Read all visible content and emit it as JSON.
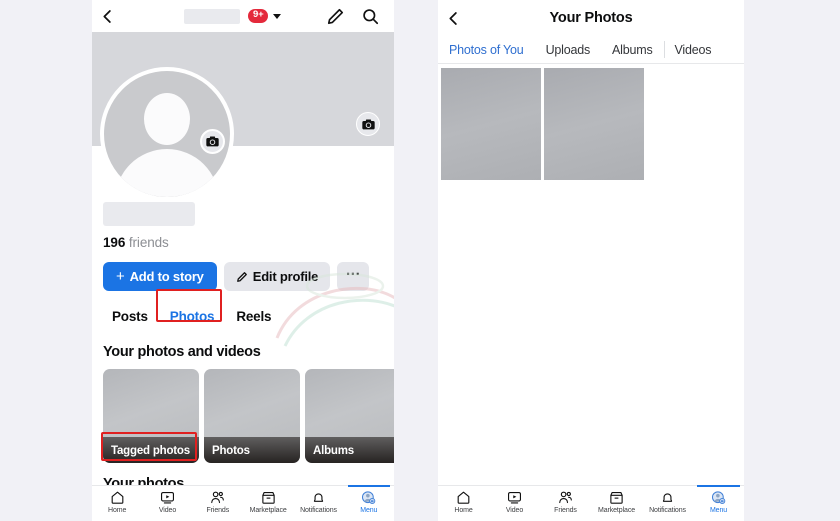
{
  "left_panel": {
    "topbar": {
      "back_icon": "chevron-left-icon",
      "name_placeholder": "",
      "notification_badge": "9+",
      "caret_icon": "chevron-down-icon",
      "edit_icon": "pencil-icon",
      "search_icon": "search-icon"
    },
    "cover": {
      "camera_icon": "camera-icon",
      "avatar_camera_icon": "camera-icon",
      "avatar": "default-avatar-placeholder"
    },
    "identity": {
      "name_placeholder": "",
      "friends_count": "196",
      "friends_label": "friends"
    },
    "actions": {
      "add_to_story": "Add to story",
      "add_icon": "plus-icon",
      "edit_profile": "Edit profile",
      "edit_icon": "pencil-icon",
      "more": "···"
    },
    "tabs": [
      {
        "label": "Posts",
        "active": false
      },
      {
        "label": "Photos",
        "active": true
      },
      {
        "label": "Reels",
        "active": false
      }
    ],
    "sections": {
      "photos_videos_heading": "Your photos and videos",
      "your_photos_heading": "Your photos"
    },
    "thumbs": [
      {
        "label": "Tagged photos"
      },
      {
        "label": "Photos"
      },
      {
        "label": "Albums"
      }
    ]
  },
  "right_panel": {
    "header": {
      "back_icon": "chevron-left-icon",
      "title": "Your Photos"
    },
    "tabs": [
      {
        "label": "Photos of You",
        "active": true
      },
      {
        "label": "Uploads",
        "active": false
      },
      {
        "label": "Albums",
        "active": false
      },
      {
        "label": "Videos",
        "active": false
      }
    ],
    "photos": [
      {
        "alt": "photo-thumbnail-1"
      },
      {
        "alt": "photo-thumbnail-2"
      }
    ]
  },
  "bottom_nav": [
    {
      "label": "Home",
      "icon": "home-icon",
      "active": false
    },
    {
      "label": "Video",
      "icon": "video-icon",
      "active": false
    },
    {
      "label": "Friends",
      "icon": "friends-icon",
      "active": false
    },
    {
      "label": "Marketplace",
      "icon": "marketplace-icon",
      "active": false
    },
    {
      "label": "Notifications",
      "icon": "bell-icon",
      "active": false
    },
    {
      "label": "Menu",
      "icon": "menu-avatar-icon",
      "active": true
    }
  ],
  "colors": {
    "accent": "#1b74e4",
    "badge": "#e4293b",
    "annotation": "#e02020",
    "page_bg": "#f1f1f6"
  }
}
